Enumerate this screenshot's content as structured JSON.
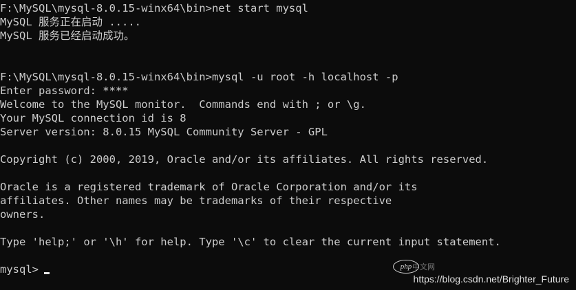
{
  "console": {
    "lines": [
      "F:\\MySQL\\mysql-8.0.15-winx64\\bin>net start mysql",
      "MySQL 服务正在启动 .....",
      "MySQL 服务已经启动成功。",
      "",
      "",
      "F:\\MySQL\\mysql-8.0.15-winx64\\bin>mysql -u root -h localhost -p",
      "Enter password: ****",
      "Welcome to the MySQL monitor.  Commands end with ; or \\g.",
      "Your MySQL connection id is 8",
      "Server version: 8.0.15 MySQL Community Server - GPL",
      "",
      "Copyright (c) 2000, 2019, Oracle and/or its affiliates. All rights reserved.",
      "",
      "Oracle is a registered trademark of Oracle Corporation and/or its",
      "affiliates. Other names may be trademarks of their respective",
      "owners.",
      "",
      "Type 'help;' or '\\h' for help. Type '\\c' to clear the current input statement.",
      ""
    ],
    "prompt": "mysql>"
  },
  "watermark": {
    "logo_text": "php",
    "logo_cn": "中文网",
    "url": "https://blog.csdn.net/Brighter_Future"
  },
  "colors": {
    "background": "#0c0c0c",
    "foreground": "#cccccc"
  }
}
